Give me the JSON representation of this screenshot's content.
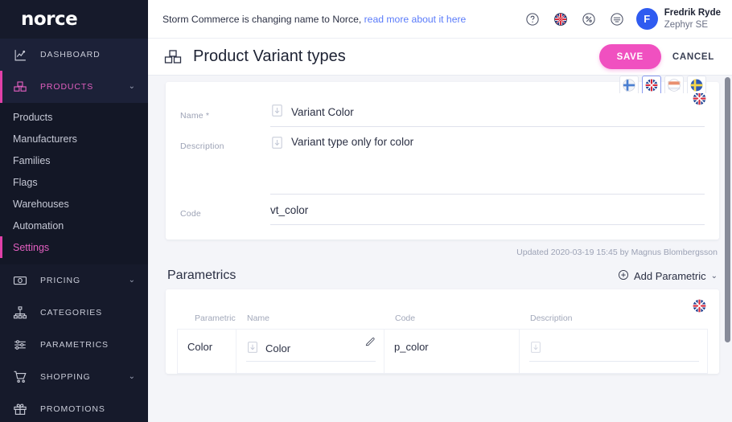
{
  "sidebar": {
    "brand": "norce",
    "groups": [
      {
        "label": "DASHBOARD",
        "icon": "chart-icon",
        "chevron": "",
        "active": false,
        "highlight": true
      },
      {
        "label": "PRODUCTS",
        "icon": "boxes-icon",
        "chevron": "⌄",
        "active": true,
        "highlight": false
      },
      {
        "label": "PRICING",
        "icon": "money-icon",
        "chevron": "⌄",
        "active": false,
        "highlight": false
      },
      {
        "label": "CATEGORIES",
        "icon": "sitemap-icon",
        "chevron": "",
        "active": false,
        "highlight": false
      },
      {
        "label": "PARAMETRICS",
        "icon": "sliders-icon",
        "chevron": "",
        "active": false,
        "highlight": false
      },
      {
        "label": "SHOPPING",
        "icon": "cart-icon",
        "chevron": "⌄",
        "active": false,
        "highlight": false
      },
      {
        "label": "PROMOTIONS",
        "icon": "gift-icon",
        "chevron": "",
        "active": false,
        "highlight": false
      }
    ],
    "products_submenu": [
      {
        "label": "Products",
        "active": false
      },
      {
        "label": "Manufacturers",
        "active": false
      },
      {
        "label": "Families",
        "active": false
      },
      {
        "label": "Flags",
        "active": false
      },
      {
        "label": "Warehouses",
        "active": false
      },
      {
        "label": "Automation",
        "active": false
      },
      {
        "label": "Settings",
        "active": true
      }
    ],
    "accent": "#e040a8",
    "bg": "#161a2b"
  },
  "topbar": {
    "banner_text": "Storm Commerce is changing name to Norce,",
    "banner_link": "read more about it here",
    "icons": [
      {
        "name": "help-icon",
        "glyph": "?"
      },
      {
        "name": "language-flag-icon",
        "glyph": ""
      },
      {
        "name": "percent-icon",
        "glyph": "%"
      },
      {
        "name": "menu-list-icon",
        "glyph": ""
      }
    ],
    "user": {
      "initial": "F",
      "name": "Fredrik Ryde",
      "org": "Zephyr SE",
      "avatar_color": "#2f5bf0"
    }
  },
  "page": {
    "title": "Product Variant types",
    "title_icon": "boxes-icon",
    "save_label": "SAVE",
    "cancel_label": "CANCEL",
    "save_color": "#f050c0"
  },
  "form": {
    "locale_flag": "uk-flag-icon",
    "flag_tabs": [
      {
        "name": "flag-tab-finland",
        "selected": false
      },
      {
        "name": "flag-tab-uk",
        "selected": true
      },
      {
        "name": "flag-tab-netherlands",
        "selected": false
      },
      {
        "name": "flag-tab-sweden",
        "selected": false
      }
    ],
    "fields": [
      {
        "label": "Name *",
        "value": "Variant Color",
        "icon": "translate-import-icon",
        "type": "text"
      },
      {
        "label": "Description",
        "value": "Variant type only for color",
        "icon": "translate-import-icon",
        "type": "textarea"
      },
      {
        "label": "Code",
        "value": "vt_color",
        "icon": "",
        "type": "text"
      }
    ],
    "updated": "Updated 2020-03-19 15:45 by Magnus Blombergsson"
  },
  "parametrics": {
    "section_title": "Parametrics",
    "add_label": "Add Parametric",
    "add_icon": "plus-circle-icon",
    "add_chevron": "⌄",
    "locale_flag": "uk-flag-icon",
    "columns": [
      "Parametric",
      "Name",
      "Code",
      "Description"
    ],
    "rows": [
      {
        "parametric": "Color",
        "name": "Color",
        "name_icon": "translate-import-icon",
        "code": "p_color",
        "description": "",
        "description_icon": "translate-import-icon",
        "edit_icon": "pencil-edit-icon"
      }
    ]
  }
}
